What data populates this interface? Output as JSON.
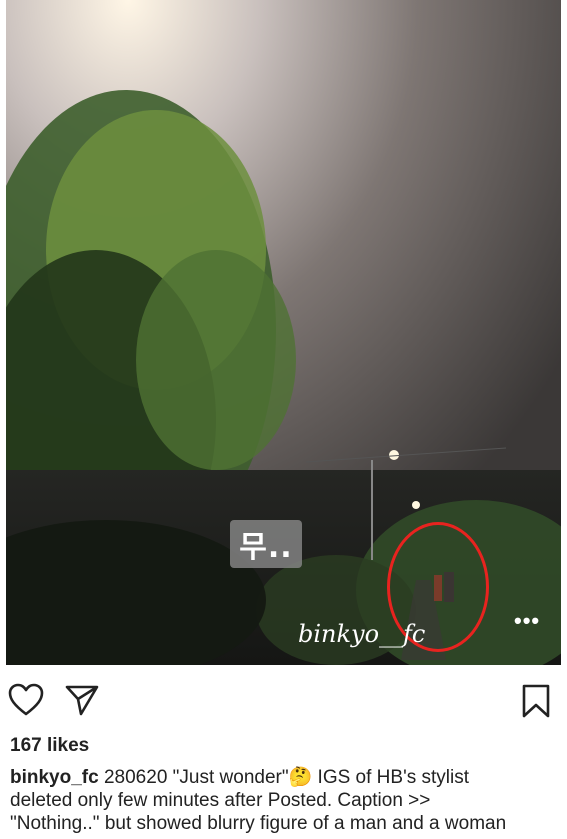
{
  "photo": {
    "overlay_badge": "무..",
    "watermark": "binkyo__fc",
    "more_label": "•••"
  },
  "actions": {
    "like_icon": "heart-icon",
    "share_icon": "send-icon",
    "save_icon": "bookmark-icon"
  },
  "post": {
    "likes": "167 likes",
    "username": "binkyo_fc",
    "caption_line1": " 280620 \"Just wonder\"",
    "thinking_emoji": "🤔",
    "caption_line1b": " IGS of HB's stylist",
    "caption_line2": "deleted only few minutes after Posted. Caption >>",
    "caption_line3": "\"Nothing..\" but showed blurry figure of a man and a woman"
  },
  "colors": {
    "circle": "#e8231f",
    "text": "#222222"
  }
}
